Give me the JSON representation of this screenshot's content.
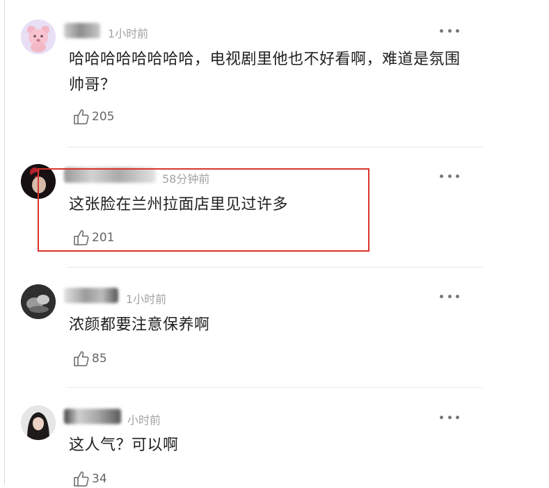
{
  "colors": {
    "highlight_border": "#d9342b",
    "time_text": "#a2a2a2",
    "like_icon": "#666666"
  },
  "comments": [
    {
      "time": "1小时前",
      "text": "哈哈哈哈哈哈哈哈，电视剧里他也不好看啊，难道是氛围帅哥？",
      "likes": "205",
      "avatar_icon": "pink-bear-avatar"
    },
    {
      "time": "58分钟前",
      "text": "这张脸在兰州拉面店里见过许多",
      "likes": "201",
      "avatar_icon": "dark-portrait-avatar"
    },
    {
      "time": "1小时前",
      "text": "浓颜都要注意保养啊",
      "likes": "85",
      "avatar_icon": "grey-photo-avatar"
    },
    {
      "time": "小时前",
      "text": "这人气？可以啊",
      "likes": "34",
      "avatar_icon": "woman-portrait-avatar"
    }
  ]
}
